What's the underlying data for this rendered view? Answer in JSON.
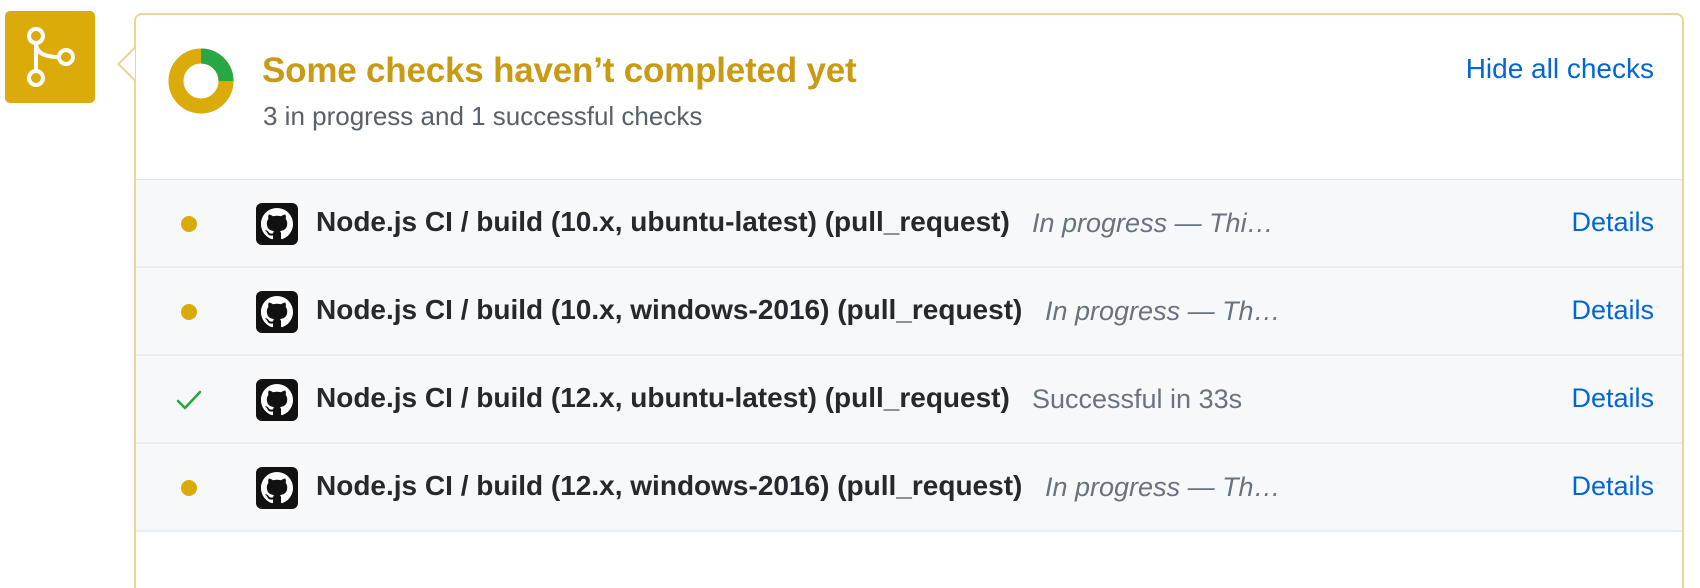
{
  "summary": {
    "title": "Some checks haven’t completed yet",
    "subtitle": "3 in progress and 1 successful checks",
    "hide_label": "Hide all checks",
    "progress": {
      "successful": 1,
      "in_progress": 3,
      "total": 4
    }
  },
  "colors": {
    "pending": "#dbab09",
    "success": "#28a745",
    "link": "#0366d6",
    "title": "#c99a14"
  },
  "icons": {
    "merge_badge": "git-branch-icon",
    "status_pending": "dot-icon",
    "status_success": "check-icon",
    "app": "github-icon"
  },
  "checks": [
    {
      "name": "Node.js CI / build (10.x, ubuntu-latest) (pull_request)",
      "description": "In progress — Thi…",
      "status": "pending",
      "details_label": "Details"
    },
    {
      "name": "Node.js CI / build (10.x, windows-2016) (pull_request)",
      "description": "In progress — Th…",
      "status": "pending",
      "details_label": "Details"
    },
    {
      "name": "Node.js CI / build (12.x, ubuntu-latest) (pull_request)",
      "description": "Successful in 33s",
      "status": "success",
      "details_label": "Details"
    },
    {
      "name": "Node.js CI / build (12.x, windows-2016) (pull_request)",
      "description": "In progress — Th…",
      "status": "pending",
      "details_label": "Details"
    }
  ]
}
